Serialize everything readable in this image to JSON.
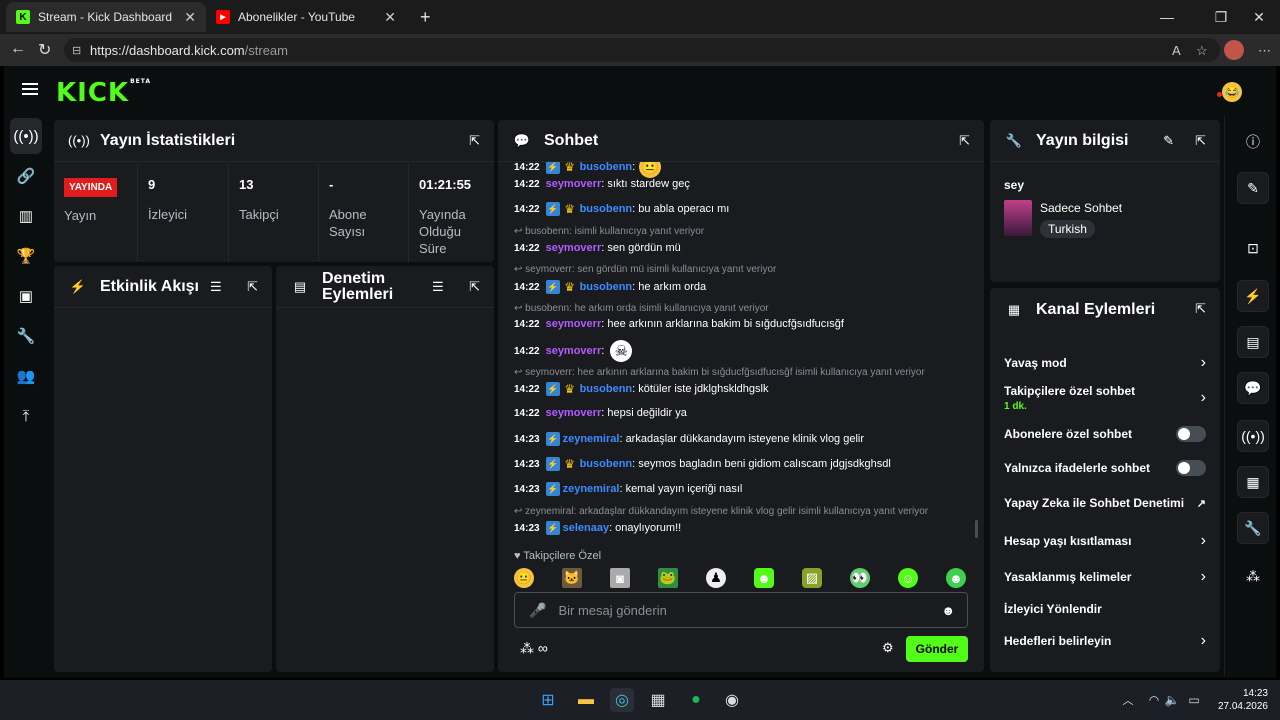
{
  "browser": {
    "tabs": [
      {
        "title": "Stream - Kick Dashboard",
        "active": true,
        "favicon": "K"
      },
      {
        "title": "Abonelikler - YouTube",
        "active": false,
        "favicon": "▶"
      }
    ],
    "url_host": "https://dashboard.kick.com",
    "url_path": "/stream"
  },
  "app": {
    "logo": "KICK",
    "logo_sup": "BETA",
    "avatar_emoji": "😂"
  },
  "stats": {
    "title": "Yayın İstatistikleri",
    "live_badge": "YAYINDA",
    "items": [
      {
        "value": "",
        "label": "Yayın"
      },
      {
        "value": "9",
        "label": "İzleyici"
      },
      {
        "value": "13",
        "label": "Takipçi"
      },
      {
        "value": "-",
        "label": "Abone Sayısı"
      },
      {
        "value": "01:21:55",
        "label": "Yayında Olduğu Süre"
      }
    ]
  },
  "activity": {
    "title": "Etkinlik Akışı"
  },
  "moderation": {
    "title": "Denetim Eylemleri"
  },
  "chat": {
    "title": "Sohbet",
    "messages": [
      {
        "time": "14:22",
        "user": "seymoverr",
        "color": "purple",
        "text": ": sıktı stardew geç"
      },
      {
        "time": "14:22",
        "user": "busobenn",
        "color": "blue",
        "text": ": bu abla operacı mı"
      },
      {
        "reply": "busobenn:  isimli kullanıcıya yanıt veriyor"
      },
      {
        "time": "14:22",
        "user": "seymoverr",
        "color": "purple",
        "text": ": sen gördün mü"
      },
      {
        "reply": "seymoverr: sen gördün mü isimli kullanıcıya yanıt veriyor"
      },
      {
        "time": "14:22",
        "user": "busobenn",
        "color": "blue",
        "text": ": he arkım orda"
      },
      {
        "reply": "busobenn: he arkım orda isimli kullanıcıya yanıt veriyor"
      },
      {
        "time": "14:22",
        "user": "seymoverr",
        "color": "purple",
        "text": ": hee arkının arklarına bakim bi sığducfğsıdfucısğf"
      },
      {
        "time": "14:22",
        "user": "seymoverr",
        "color": "purple",
        "text": ":"
      },
      {
        "reply": "seymoverr: hee arkının arklarına bakim bi sığducfğsıdfucısğf isimli kullanıcıya yanıt veriyor"
      },
      {
        "time": "14:22",
        "user": "busobenn",
        "color": "blue",
        "text": ": kötüler iste jdklghskldhgslk"
      },
      {
        "time": "14:22",
        "user": "seymoverr",
        "color": "purple",
        "text": ": hepsi değildir ya"
      },
      {
        "time": "14:23",
        "user": "zeynemiral",
        "color": "blue",
        "text": ": arkadaşlar dükkandayım isteyene klinik vlog gelir"
      },
      {
        "time": "14:23",
        "user": "busobenn",
        "color": "blue",
        "text": ": seymos bagladın beni gidiom calıscam jdgjsdkghsdl"
      },
      {
        "time": "14:23",
        "user": "zeynemiral",
        "color": "blue",
        "text": ": kemal yayın içeriği nasıl"
      },
      {
        "reply": "zeynemiral: arkadaşlar dükkandayım isteyene klinik vlog gelir isimli kullanıcıya yanıt veriyor"
      },
      {
        "time": "14:23",
        "user": "selenaay",
        "color": "blue",
        "text": ": onaylıyorum!!"
      }
    ],
    "followers_only_label": "Takipçilere Özel",
    "input_placeholder": "Bir mesaj gönderin",
    "send_label": "Gönder"
  },
  "stream_info": {
    "title": "Yayın bilgisi",
    "stream_title": "sey",
    "category": "Sadece Sohbet",
    "language": "Turkish"
  },
  "channel_actions": {
    "title": "Kanal Eylemleri",
    "rows": [
      {
        "label": "Yavaş mod",
        "control": "chevron"
      },
      {
        "label": "Takipçilere özel sohbet",
        "sub": "1 dk.",
        "control": "chevron"
      },
      {
        "label": "Abonelere özel sohbet",
        "control": "toggle"
      },
      {
        "label": "Yalnızca ifadelerle sohbet",
        "control": "toggle"
      },
      {
        "label": "Yapay Zeka ile Sohbet Denetimi",
        "control": "external"
      },
      {
        "label": "Hesap yaşı kısıtlaması",
        "control": "chevron"
      },
      {
        "label": "Yasaklanmış kelimeler",
        "control": "chevron"
      },
      {
        "label": "İzleyici Yönlendir",
        "control": "none"
      },
      {
        "label": "Hedefleri belirleyin",
        "control": "chevron"
      }
    ]
  },
  "taskbar": {
    "time": "14:23",
    "date": "27.04.2026"
  },
  "colors": {
    "brand": "#53fc18",
    "panel": "#191b1f",
    "bg": "#0b0e0f",
    "live": "#e21c1c"
  }
}
